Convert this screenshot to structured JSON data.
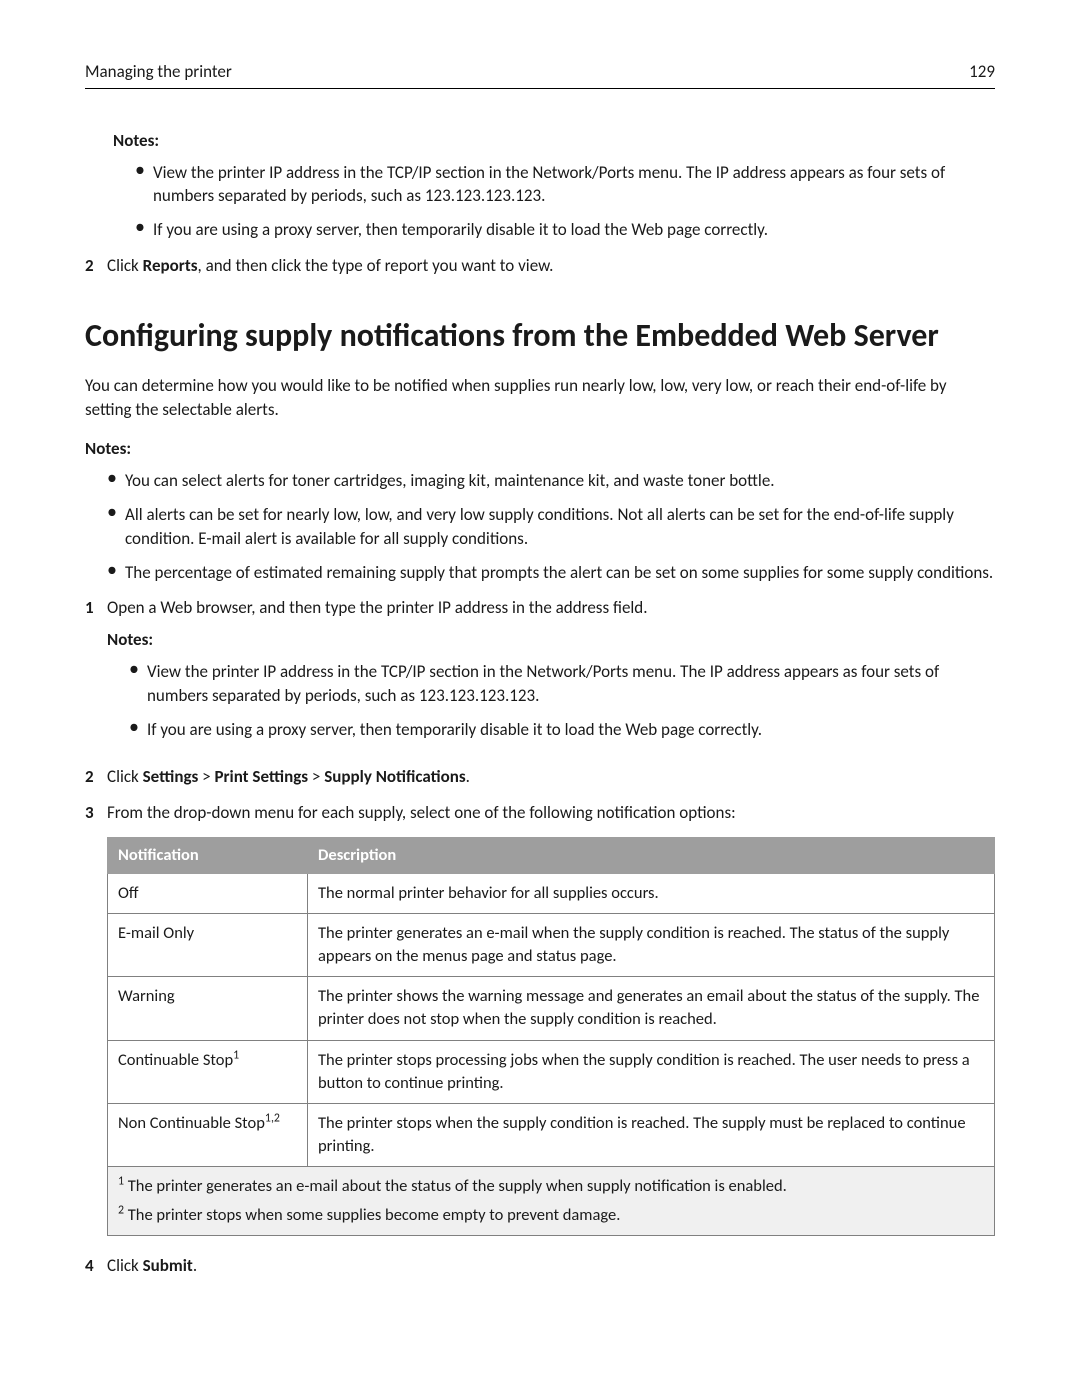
{
  "header": {
    "title": "Managing the printer",
    "page_number": "129"
  },
  "top_notes": {
    "label": "Notes:",
    "bullets": [
      "View the printer IP address in the TCP/IP section in the Network/Ports menu. The IP address appears as four sets of numbers separated by periods, such as 123.123.123.123.",
      "If you are using a proxy server, then temporarily disable it to load the Web page correctly."
    ]
  },
  "top_step2": {
    "num": "2",
    "pre": "Click ",
    "bold": "Reports",
    "post": ", and then click the type of report you want to view."
  },
  "section": {
    "title": "Configuring supply notifications from the Embedded Web Server",
    "intro": "You can determine how you would like to be notified when supplies run nearly low, low, very low, or reach their end-of-life by setting the selectable alerts.",
    "notes_label": "Notes:",
    "notes_bullets": [
      "You can select alerts for toner cartridges, imaging kit, maintenance kit, and waste toner bottle.",
      "All alerts can be set for nearly low, low, and very low supply conditions. Not all alerts can be set for the end-of-life supply condition. E-mail alert is available for all supply conditions.",
      "The percentage of estimated remaining supply that prompts the alert can be set on some supplies for some supply conditions."
    ],
    "step1": {
      "num": "1",
      "text": "Open a Web browser, and then type the printer IP address in the address field.",
      "notes_label": "Notes:",
      "bullets": [
        "View the printer IP address in the TCP/IP section in the Network/Ports menu. The IP address appears as four sets of numbers separated by periods, such as 123.123.123.123.",
        "If you are using a proxy server, then temporarily disable it to load the Web page correctly."
      ]
    },
    "step2": {
      "num": "2",
      "pre": "Click ",
      "b1": "Settings",
      "gt1": " > ",
      "b2": "Print Settings",
      "gt2": " > ",
      "b3": "Supply Notifications",
      "post": "."
    },
    "step3": {
      "num": "3",
      "text": "From the drop-down menu for each supply, select one of the following notification options:"
    },
    "table": {
      "head_col1": "Notification",
      "head_col2": "Description",
      "rows": [
        {
          "name": "Off",
          "sup": "",
          "desc": "The normal printer behavior for all supplies occurs."
        },
        {
          "name": "E-mail Only",
          "sup": "",
          "desc": "The printer generates an e-mail when the supply condition is reached. The status of the supply appears on the menus page and status page."
        },
        {
          "name": "Warning",
          "sup": "",
          "desc": "The printer shows the warning message and generates an email about the status of the supply. The printer does not stop when the supply condition is reached."
        },
        {
          "name": "Continuable Stop",
          "sup": "1",
          "desc": "The printer stops processing jobs when the supply condition is reached. The user needs to press a button to continue printing."
        },
        {
          "name": "Non Continuable Stop",
          "sup": "1,2",
          "desc": "The printer stops when the supply condition is reached. The supply must be replaced to continue printing."
        }
      ],
      "footnote1_sup": "1",
      "footnote1": " The printer generates an e-mail about the status of the supply when supply notification is enabled.",
      "footnote2_sup": "2",
      "footnote2": " The printer stops when some supplies become empty to prevent damage."
    },
    "step4": {
      "num": "4",
      "pre": "Click ",
      "bold": "Submit",
      "post": "."
    }
  }
}
